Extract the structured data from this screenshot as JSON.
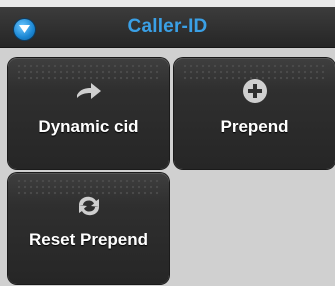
{
  "header": {
    "title": "Caller-ID",
    "collapse_icon": "chevron-down-icon",
    "accent_color": "#3aa0e6"
  },
  "tiles": [
    {
      "label": "Dynamic cid",
      "icon": "arrow-right-icon"
    },
    {
      "label": "Prepend",
      "icon": "plus-icon"
    },
    {
      "label": "Reset Prepend",
      "icon": "refresh-icon"
    }
  ]
}
